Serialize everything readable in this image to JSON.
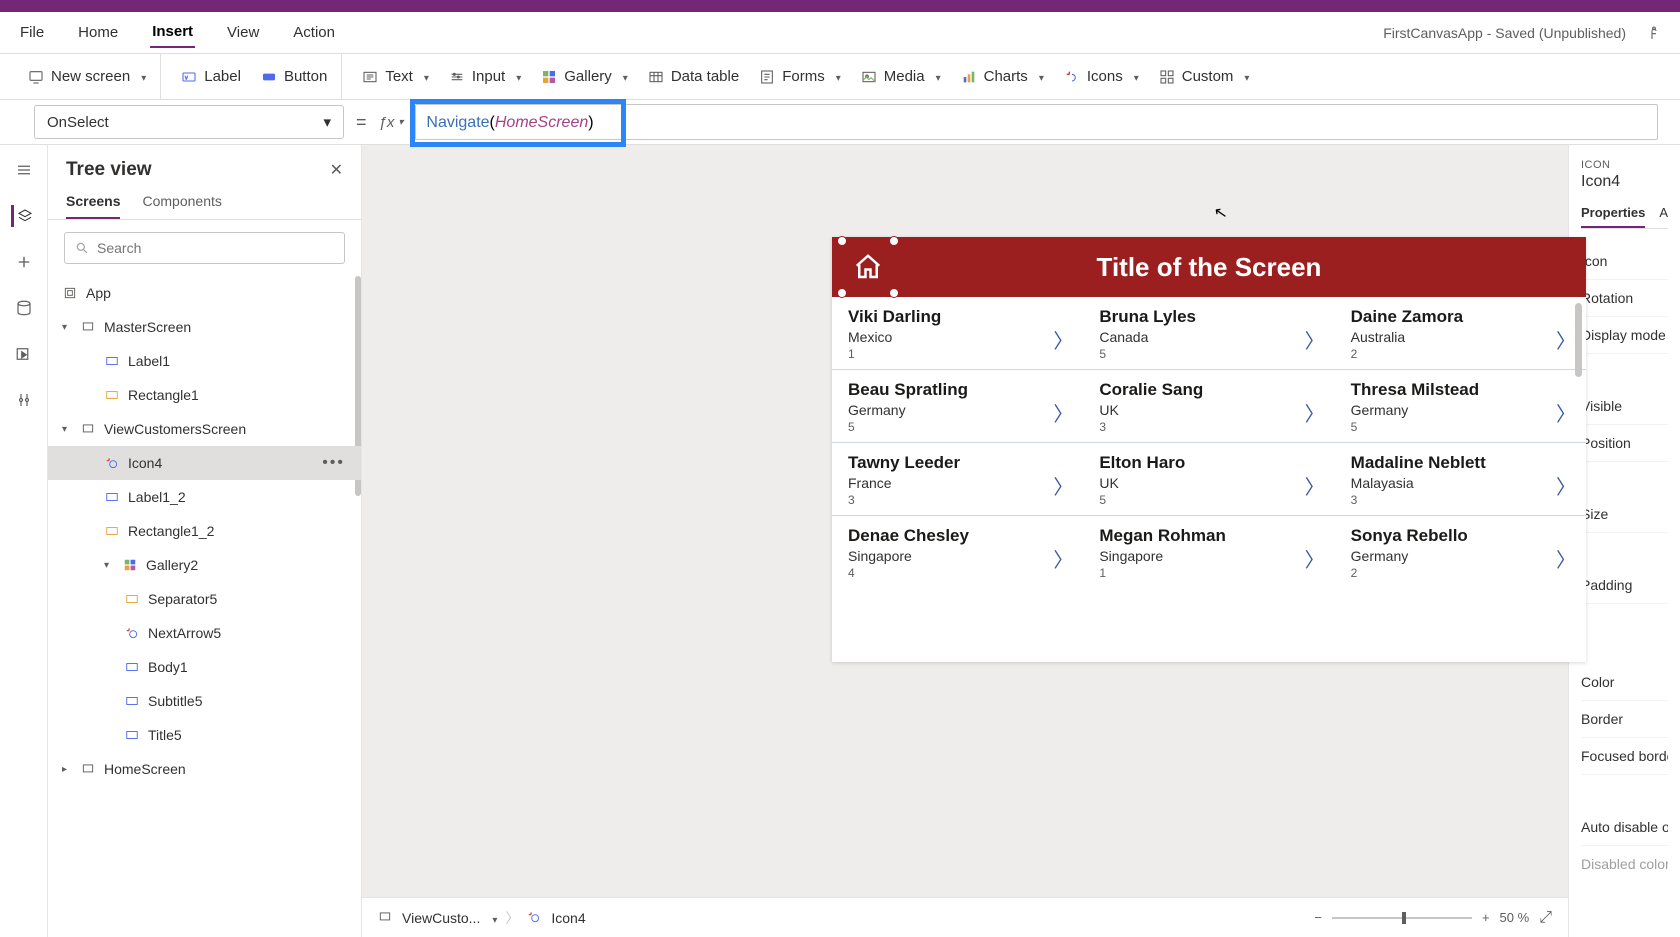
{
  "appStatus": "FirstCanvasApp - Saved (Unpublished)",
  "menu": {
    "file": "File",
    "home": "Home",
    "insert": "Insert",
    "view": "View",
    "action": "Action"
  },
  "ribbon": {
    "newScreen": "New screen",
    "label": "Label",
    "button": "Button",
    "text": "Text",
    "input": "Input",
    "gallery": "Gallery",
    "dataTable": "Data table",
    "forms": "Forms",
    "media": "Media",
    "charts": "Charts",
    "icons": "Icons",
    "custom": "Custom"
  },
  "formula": {
    "property": "OnSelect",
    "fn": "Navigate",
    "arg": "HomeScreen"
  },
  "tree": {
    "title": "Tree view",
    "tabs": {
      "screens": "Screens",
      "components": "Components"
    },
    "searchPlaceholder": "Search",
    "items": {
      "app": "App",
      "master": "MasterScreen",
      "label1": "Label1",
      "rect1": "Rectangle1",
      "view": "ViewCustomersScreen",
      "icon4": "Icon4",
      "label12": "Label1_2",
      "rect12": "Rectangle1_2",
      "gallery2": "Gallery2",
      "sep5": "Separator5",
      "next5": "NextArrow5",
      "body1": "Body1",
      "sub5": "Subtitle5",
      "title5": "Title5",
      "home": "HomeScreen"
    }
  },
  "screen": {
    "title": "Title of the Screen",
    "rows": [
      [
        {
          "n": "Viki  Darling",
          "c": "Mexico",
          "v": "1"
        },
        {
          "n": "Bruna  Lyles",
          "c": "Canada",
          "v": "5"
        },
        {
          "n": "Daine  Zamora",
          "c": "Australia",
          "v": "2"
        }
      ],
      [
        {
          "n": "Beau  Spratling",
          "c": "Germany",
          "v": "5"
        },
        {
          "n": "Coralie  Sang",
          "c": "UK",
          "v": "3"
        },
        {
          "n": "Thresa  Milstead",
          "c": "Germany",
          "v": "5"
        }
      ],
      [
        {
          "n": "Tawny  Leeder",
          "c": "France",
          "v": "3"
        },
        {
          "n": "Elton  Haro",
          "c": "UK",
          "v": "5"
        },
        {
          "n": "Madaline  Neblett",
          "c": "Malayasia",
          "v": "3"
        }
      ],
      [
        {
          "n": "Denae  Chesley",
          "c": "Singapore",
          "v": "4"
        },
        {
          "n": "Megan  Rohman",
          "c": "Singapore",
          "v": "1"
        },
        {
          "n": "Sonya  Rebello",
          "c": "Germany",
          "v": "2"
        }
      ]
    ]
  },
  "breadcrumb": {
    "screen": "ViewCusto...",
    "control": "Icon4"
  },
  "zoom": {
    "value": "50",
    "unit": "%"
  },
  "props": {
    "category": "ICON",
    "name": "Icon4",
    "tab1": "Properties",
    "tab2": "A",
    "rows": [
      "Icon",
      "Rotation",
      "Display mode",
      "Visible",
      "Position",
      "Size",
      "Padding",
      "Color",
      "Border",
      "Focused border",
      "Auto disable on s",
      "Disabled color"
    ]
  }
}
